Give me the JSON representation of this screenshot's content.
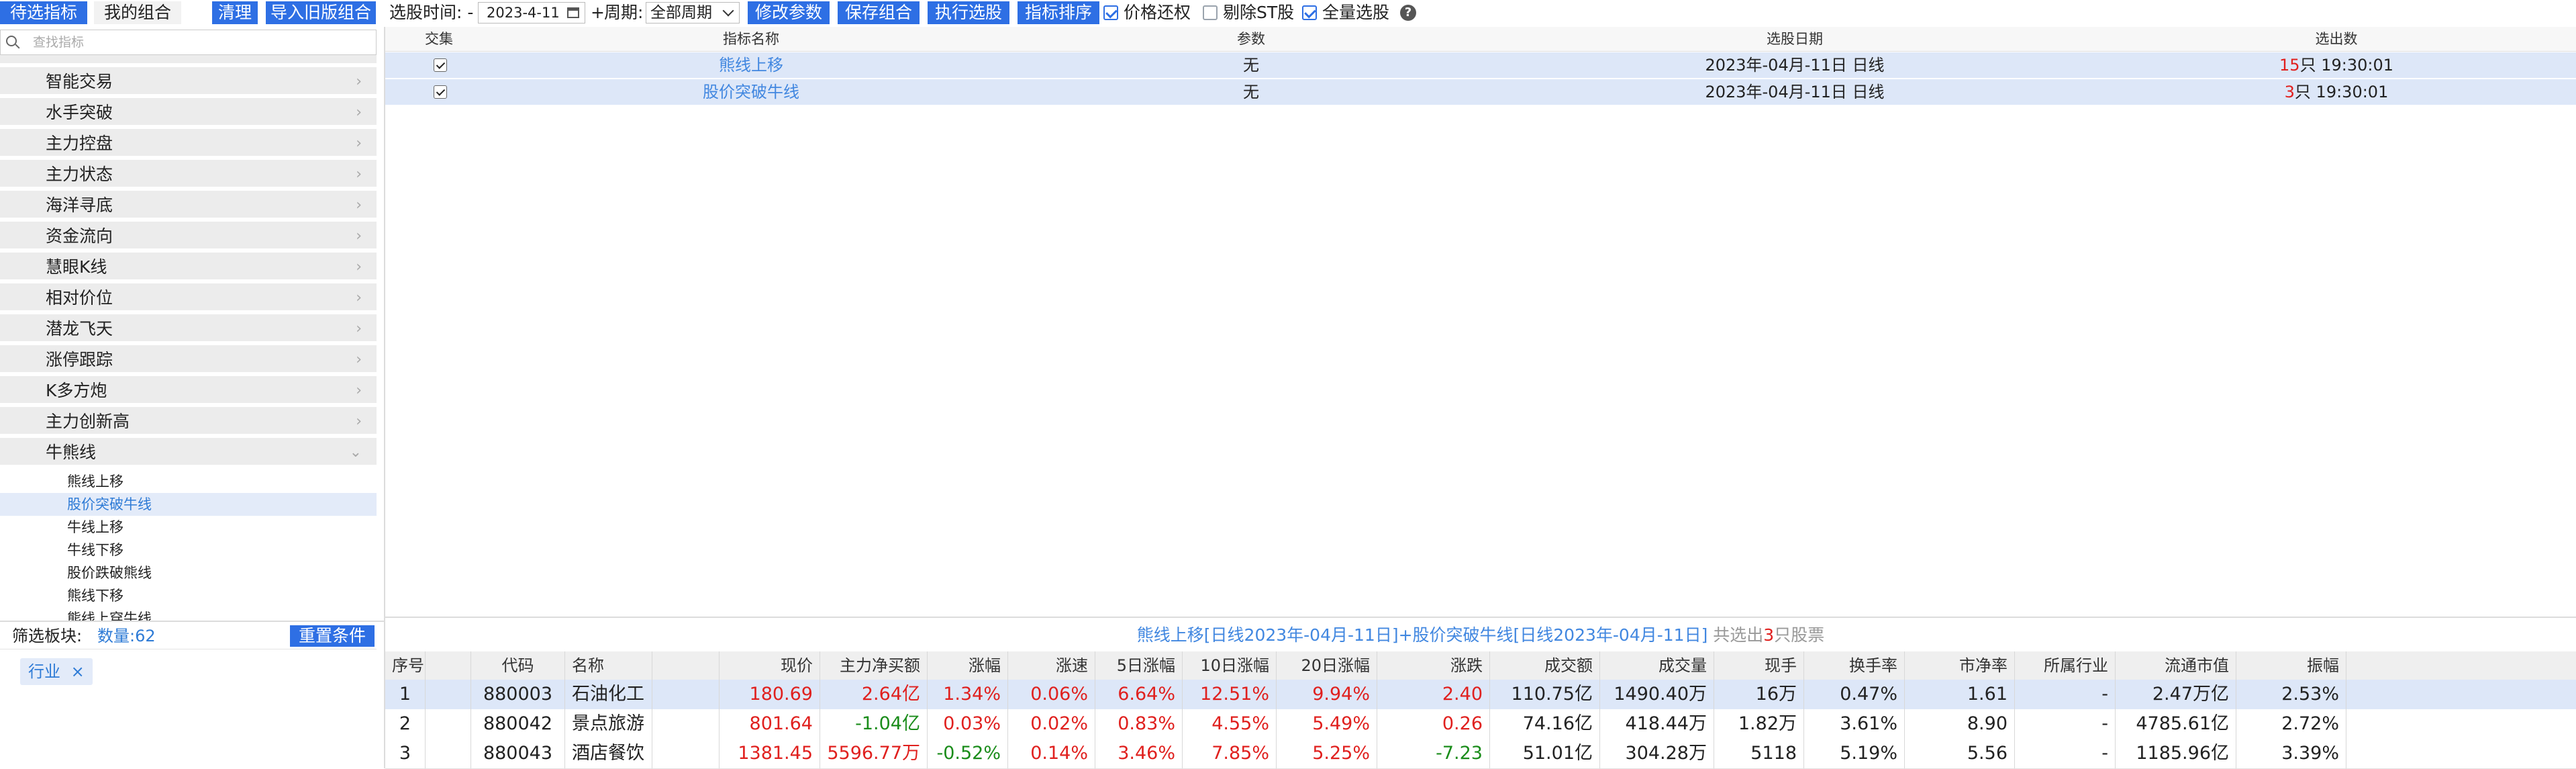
{
  "toolbar": {
    "tab_pending": "待选指标",
    "tab_my": "我的组合",
    "clear": "清理",
    "import": "导入旧版组合",
    "time_label": "选股时间: -",
    "date_value": "2023-4-11",
    "plus": "+",
    "period_label": "周期:",
    "period_value": "全部周期",
    "modify": "修改参数",
    "save": "保存组合",
    "run": "执行选股",
    "sort": "指标排序",
    "price_adjust": "价格还权",
    "exclude_st": "剔除ST股",
    "all_select": "全量选股",
    "help": "?"
  },
  "sidebar": {
    "search_placeholder": "查找指标",
    "categories": [
      "智能交易",
      "水手突破",
      "主力控盘",
      "主力状态",
      "海洋寻底",
      "资金流向",
      "慧眼K线",
      "相对价位",
      "潜龙飞天",
      "涨停跟踪",
      "K多方炮",
      "主力创新高",
      "牛熊线"
    ],
    "subitems": [
      "熊线上移",
      "股价突破牛线",
      "牛线上移",
      "牛线下移",
      "股价跌破熊线",
      "熊线下移",
      "熊线上穿牛线"
    ],
    "selected_sub": 1,
    "filter_label": "筛选板块:",
    "count_label": "数量:62",
    "reset": "重置条件",
    "tag": "行业",
    "tag_close": "×"
  },
  "top_table": {
    "headers": [
      "交集",
      "指标名称",
      "参数",
      "选股日期",
      "选出数"
    ],
    "rows": [
      {
        "name": "熊线上移",
        "param": "无",
        "date": "2023年-04月-11日 日线",
        "count": "15",
        "count_suffix": "只 19:30:01"
      },
      {
        "name": "股价突破牛线",
        "param": "无",
        "date": "2023年-04月-11日 日线",
        "count": "3",
        "count_suffix": "只 19:30:01"
      }
    ]
  },
  "summary": {
    "text": "熊线上移[日线2023年-04月-11日]+股价突破牛线[日线2023年-04月-11日]",
    "total_prefix": " 共选出",
    "total": "3",
    "total_suffix": "只股票"
  },
  "stock_table": {
    "headers": [
      "序号",
      "代码",
      "名称",
      "现价",
      "主力净买额",
      "涨幅",
      "涨速",
      "5日涨幅",
      "10日涨幅",
      "20日涨幅",
      "涨跌",
      "成交额",
      "成交量",
      "现手",
      "换手率",
      "市净率",
      "所属行业",
      "流通市值",
      "振幅"
    ],
    "rows": [
      {
        "idx": "1",
        "code": "880003",
        "name": "石油化工",
        "price": "180.69",
        "net": "2.64亿",
        "chg": "1.34%",
        "speed": "0.06%",
        "d5": "6.64%",
        "d10": "12.51%",
        "d20": "9.94%",
        "diff": "2.40",
        "amount": "110.75亿",
        "volume": "1490.40万",
        "hand": "16万",
        "turnover": "0.47%",
        "pb": "1.61",
        "industry": "-",
        "mcap": "2.47万亿",
        "amp": "2.53%"
      },
      {
        "idx": "2",
        "code": "880042",
        "name": "景点旅游",
        "price": "801.64",
        "net": "-1.04亿",
        "chg": "0.03%",
        "speed": "0.02%",
        "d5": "0.83%",
        "d10": "4.55%",
        "d20": "5.49%",
        "diff": "0.26",
        "amount": "74.16亿",
        "volume": "418.44万",
        "hand": "1.82万",
        "turnover": "3.61%",
        "pb": "8.90",
        "industry": "-",
        "mcap": "4785.61亿",
        "amp": "2.72%"
      },
      {
        "idx": "3",
        "code": "880043",
        "name": "酒店餐饮",
        "price": "1381.45",
        "net": "5596.77万",
        "chg": "-0.52%",
        "speed": "0.14%",
        "d5": "3.46%",
        "d10": "7.85%",
        "d20": "5.25%",
        "diff": "-7.23",
        "amount": "51.01亿",
        "volume": "304.28万",
        "hand": "5118",
        "turnover": "5.19%",
        "pb": "5.56",
        "industry": "-",
        "mcap": "1185.96亿",
        "amp": "3.39%"
      }
    ]
  },
  "colors": {
    "accent": "#2e6fe4",
    "up": "#e0201e",
    "down": "#1a8c1a",
    "selected_row": "#dde7f8"
  }
}
